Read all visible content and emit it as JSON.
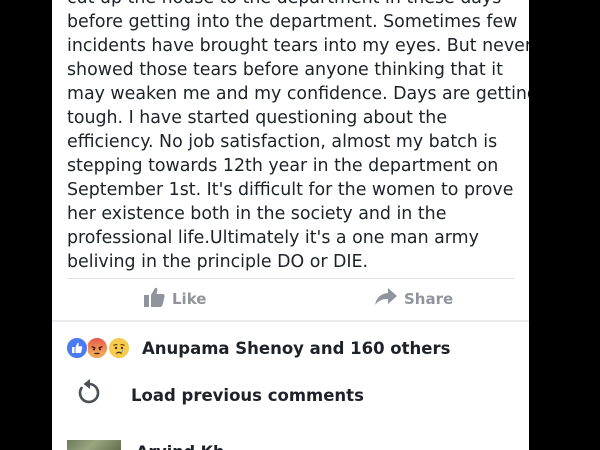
{
  "post": {
    "lines": [
      "cut up the house to the department in these days",
      "before getting into the department. Sometimes few",
      "incidents have brought tears into my eyes. But never",
      "showed those tears before anyone thinking that it",
      "may weaken me and my confidence. Days are getting",
      "tough. I have started questioning about the",
      "efficiency. No job satisfaction, almost my batch is",
      "stepping towards 12th year in the department on",
      "September 1st. It's difficult for the women to prove",
      "her existence both in the society  and in the",
      "professional life.Ultimately it's a one man army",
      "beliving in the principle DO or DIE."
    ]
  },
  "actions": {
    "like_label": "Like",
    "share_label": "Share",
    "icon_color": "#90949c"
  },
  "reactions": {
    "icons": [
      "like-icon",
      "angry-icon",
      "sad-icon"
    ],
    "summary": "Anupama Shenoy and 160 others"
  },
  "comments": {
    "load_previous_label": "Load previous comments",
    "first_author": "Arvind Kh"
  }
}
